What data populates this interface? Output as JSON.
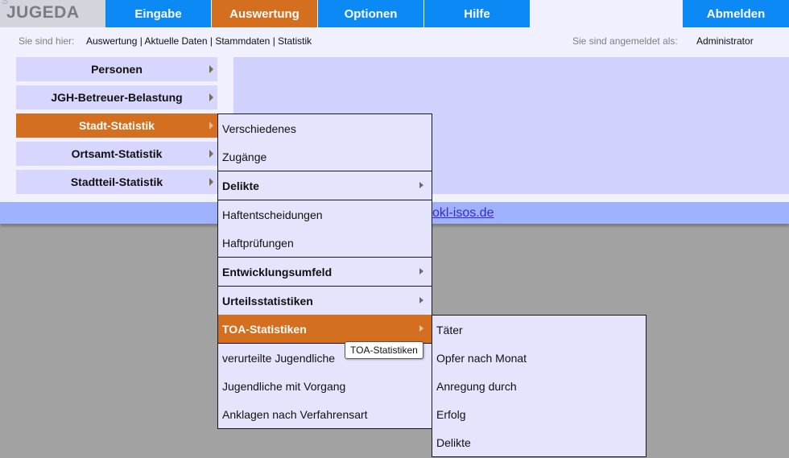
{
  "logo": {
    "text": "JUGEDA"
  },
  "nav": {
    "items": [
      {
        "label": "Eingabe",
        "active": false
      },
      {
        "label": "Auswertung",
        "active": true
      },
      {
        "label": "Optionen",
        "active": false
      },
      {
        "label": "Hilfe",
        "active": false
      }
    ],
    "logout": "Abmelden"
  },
  "breadcrumb": {
    "label": "Sie sind hier:",
    "path": "Auswertung | Aktuelle Daten | Stammdaten | Statistik"
  },
  "login": {
    "label": "Sie sind angemeldet als:",
    "user": "Administrator"
  },
  "sidebar": {
    "items": [
      {
        "label": "Personen"
      },
      {
        "label": "JGH-Betreuer-Belastung"
      },
      {
        "label": "Stadt-Statistik"
      },
      {
        "label": "Ortsamt-Statistik"
      },
      {
        "label": "Stadtteil-Statistik"
      }
    ]
  },
  "footer": {
    "link": "okl-isos.de"
  },
  "menu": {
    "items": [
      {
        "label": "Verschiedenes"
      },
      {
        "label": "Zugänge"
      },
      {
        "label": "Delikte"
      },
      {
        "label": "Haftentscheidungen"
      },
      {
        "label": "Haftprüfungen"
      },
      {
        "label": "Entwicklungsumfeld"
      },
      {
        "label": "Urteilsstatistiken"
      },
      {
        "label": "TOA-Statistiken"
      },
      {
        "label": "verurteilte Jugendliche"
      },
      {
        "label": "Jugendliche mit Vorgang"
      },
      {
        "label": "Anklagen nach Verfahrensart"
      }
    ]
  },
  "submenu": {
    "items": [
      {
        "label": "Täter"
      },
      {
        "label": "Opfer nach Monat"
      },
      {
        "label": "Anregung durch"
      },
      {
        "label": "Erfolg"
      },
      {
        "label": "Delikte"
      }
    ]
  },
  "tooltip": {
    "text": "TOA-Statistiken"
  },
  "colors": {
    "nav_blue": "#0b8af5",
    "accent_orange": "#d46f1f",
    "panel_lavender": "#d1d1fd",
    "menu_bg": "#e4e4fd",
    "footer_blue": "#9fb2fd",
    "page_grey": "#a2a2a2"
  }
}
